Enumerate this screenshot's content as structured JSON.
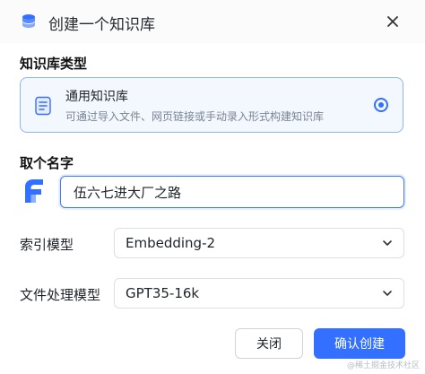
{
  "dialog": {
    "title": "创建一个知识库",
    "header_icon": "database-icon",
    "close_icon": "close-icon"
  },
  "type_section": {
    "label": "知识库类型",
    "options": [
      {
        "title": "通用知识库",
        "description": "可通过导入文件、网页链接或手动录入形式构建知识库",
        "icon": "document-list-icon",
        "selected": true
      }
    ]
  },
  "name_section": {
    "label": "取个名字",
    "value": "伍六七进大厂之路",
    "avatar_icon": "app-logo-icon"
  },
  "index_model": {
    "label": "索引模型",
    "value": "Embedding-2"
  },
  "file_model": {
    "label": "文件处理模型",
    "value": "GPT35-16k"
  },
  "actions": {
    "cancel": "关闭",
    "confirm": "确认创建"
  },
  "watermark": "@稀土掘金技术社区",
  "colors": {
    "primary": "#3370ff",
    "card_border": "#8fb5f2",
    "card_bg": "#f3f7fe"
  }
}
